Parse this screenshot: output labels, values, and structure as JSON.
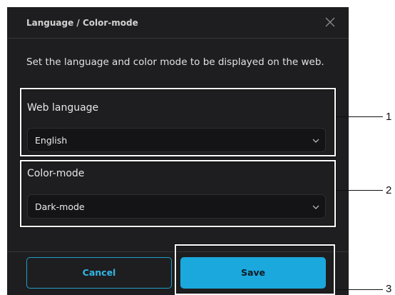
{
  "dialog": {
    "title": "Language / Color-mode",
    "description": "Set the language and color mode to be displayed on the web."
  },
  "fields": {
    "web_language": {
      "label": "Web language",
      "value": "English"
    },
    "color_mode": {
      "label": "Color-mode",
      "value": "Dark-mode"
    }
  },
  "buttons": {
    "cancel": "Cancel",
    "save": "Save"
  },
  "callouts": [
    "1",
    "2",
    "3"
  ],
  "colors": {
    "dialog_bg": "#1e1e20",
    "accent": "#1ba8dc",
    "field_bg": "#141417"
  }
}
